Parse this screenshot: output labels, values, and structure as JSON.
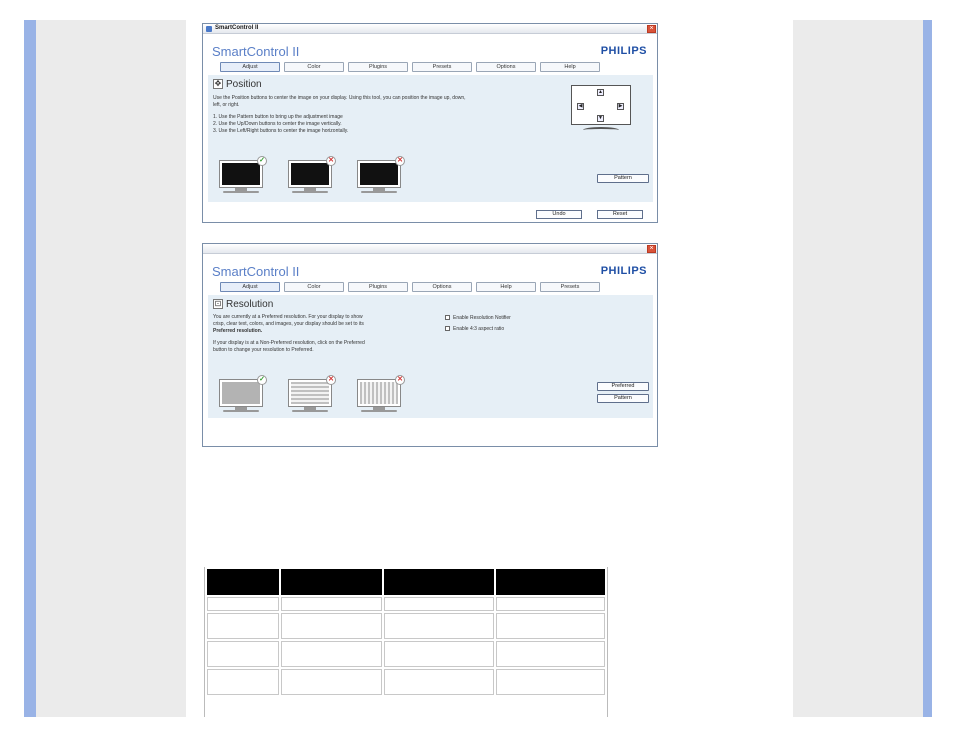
{
  "window1": {
    "title": "SmartControl II",
    "brand": "SmartControl II",
    "logo": "PHILIPS",
    "tabs": [
      {
        "label": "Adjust",
        "active": true
      },
      {
        "label": "Color",
        "active": false
      },
      {
        "label": "Plugins",
        "active": false
      },
      {
        "label": "Presets",
        "active": false
      },
      {
        "label": "Options",
        "active": false
      },
      {
        "label": "Help",
        "active": false
      }
    ],
    "section_title": "Position",
    "intro_line1": "Use the Position buttons to center the image on your display. Using this tool, you can position the image up, down,",
    "intro_line2": "left, or right.",
    "steps": [
      "1. Use the Pattern button to bring up the adjustment image",
      "2. Use the Up/Down buttons to center the image vertically.",
      "3. Use the Left/Right buttons to center the image horizontally."
    ],
    "pattern_button": "Pattern",
    "undo_button": "Undo",
    "reset_button": "Reset"
  },
  "window2": {
    "brand": "SmartControl II",
    "logo": "PHILIPS",
    "tabs": [
      {
        "label": "Adjust",
        "active": true
      },
      {
        "label": "Color",
        "active": false
      },
      {
        "label": "Plugins",
        "active": false
      },
      {
        "label": "Options",
        "active": false
      },
      {
        "label": "Help",
        "active": false
      },
      {
        "label": "Presets",
        "active": false
      }
    ],
    "section_title": "Resolution",
    "para1_line1": "You are currently at a Preferred resolution. For your display to show",
    "para1_line2": "crisp, clear text, colors, and images, your display should be set to its",
    "para1_line3": "Preferred resolution.",
    "para2_line1": "If your display is at a Non-Preferred resolution, click on the Preferred",
    "para2_line2": "button to change your resolution to Preferred.",
    "checkbox1": "Enable Resolution Notifier",
    "checkbox2": "Enable 4:3 aspect ratio",
    "preferred_button": "Preferred",
    "pattern_button": "Pattern"
  },
  "colors": {
    "brand_blue": "#5a7fc7",
    "logo_blue": "#1f4fa5",
    "panel_bg": "#e6eff6",
    "side_blue": "#99b3e6",
    "side_gray": "#ebebeb",
    "ok_green": "#2f9b2f",
    "error_red": "#d03030"
  }
}
